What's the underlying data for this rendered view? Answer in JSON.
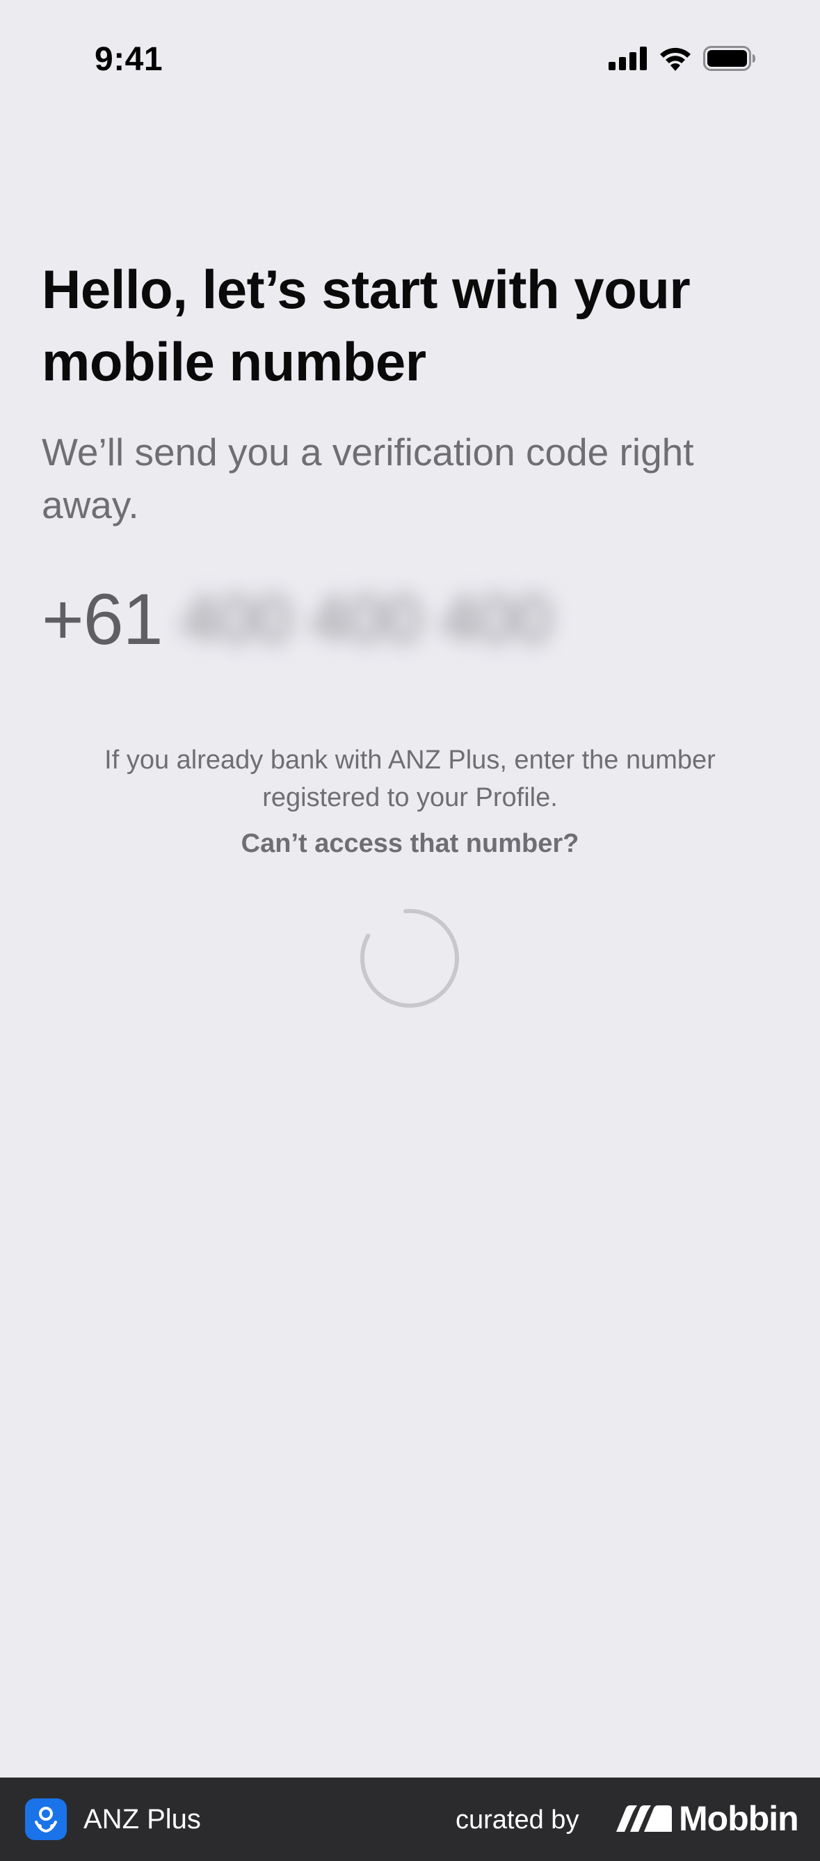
{
  "status_bar": {
    "time": "9:41"
  },
  "screen": {
    "title": "Hello, let’s start with your mobile number",
    "subtitle": "We’ll send you a verification code right away.",
    "phone": {
      "country_code": "+61",
      "value": "400 400 400"
    },
    "helper_text": "If you already bank with ANZ Plus, enter the number registered to your Profile.",
    "help_link": "Can’t access that number?"
  },
  "footer": {
    "app_name": "ANZ Plus",
    "curated_by": "curated by",
    "brand": "Mobbin"
  },
  "colors": {
    "background": "#ebebf0",
    "title": "#0a0a0a",
    "secondary_text": "#6e6e73",
    "footer_bg": "#2b2b2d",
    "app_badge": "#1a73e8"
  },
  "icons": {
    "status": [
      "cellular-signal-icon",
      "wifi-icon",
      "battery-icon"
    ],
    "loading": "loading-spinner-icon",
    "app": "anz-plus-app-icon",
    "brand": "mobbin-logo-icon"
  }
}
